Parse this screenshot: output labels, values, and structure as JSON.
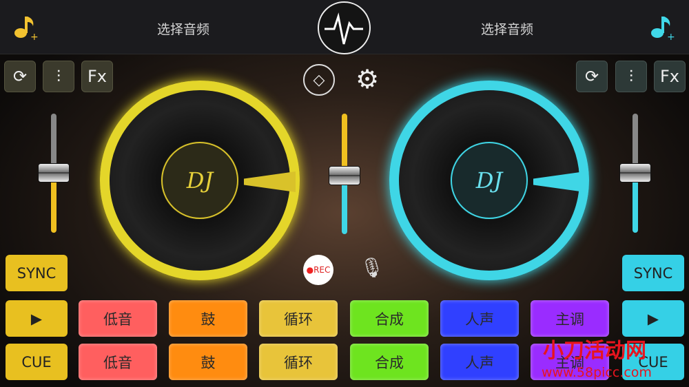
{
  "header": {
    "left_title": "选择音频",
    "right_title": "选择音频",
    "left_icon": "music-add-icon",
    "right_icon": "music-add-icon",
    "center_icon": "waveform-pulse-icon"
  },
  "left_toolbar": {
    "sync_loop": "loop-icon",
    "eq": "equalizer-icon",
    "fx_label": "Fx"
  },
  "right_toolbar": {
    "sync_loop": "loop-icon",
    "eq": "equalizer-icon",
    "fx_label": "Fx"
  },
  "center": {
    "vip_icon": "diamond-icon",
    "settings_icon": "gear-icon",
    "rec_label": "REC",
    "mic_icon": "microphone-icon"
  },
  "decks": {
    "left": {
      "label": "DJ",
      "color": "#e6d62a"
    },
    "right": {
      "label": "DJ",
      "color": "#3fd6e6"
    }
  },
  "sliders": {
    "left_volume": 0.5,
    "crossfader": 0.5,
    "right_volume": 0.5
  },
  "left_controls": {
    "sync": "SYNC",
    "play_icon": "play-icon",
    "cue": "CUE"
  },
  "right_controls": {
    "sync": "SYNC",
    "play_icon": "play-icon",
    "cue": "CUE"
  },
  "pads": {
    "row1": [
      "低音",
      "鼓",
      "循环",
      "合成",
      "人声",
      "主调"
    ],
    "row2": [
      "低音",
      "鼓",
      "循环",
      "合成",
      "人声",
      "主调"
    ],
    "colors": [
      "#ff5f5f",
      "#ff8c10",
      "#e8c43a",
      "#6ee41f",
      "#3040ff",
      "#9a2cff"
    ]
  },
  "watermark": {
    "text": "小刀活动网",
    "url": "www.58picc.com"
  }
}
